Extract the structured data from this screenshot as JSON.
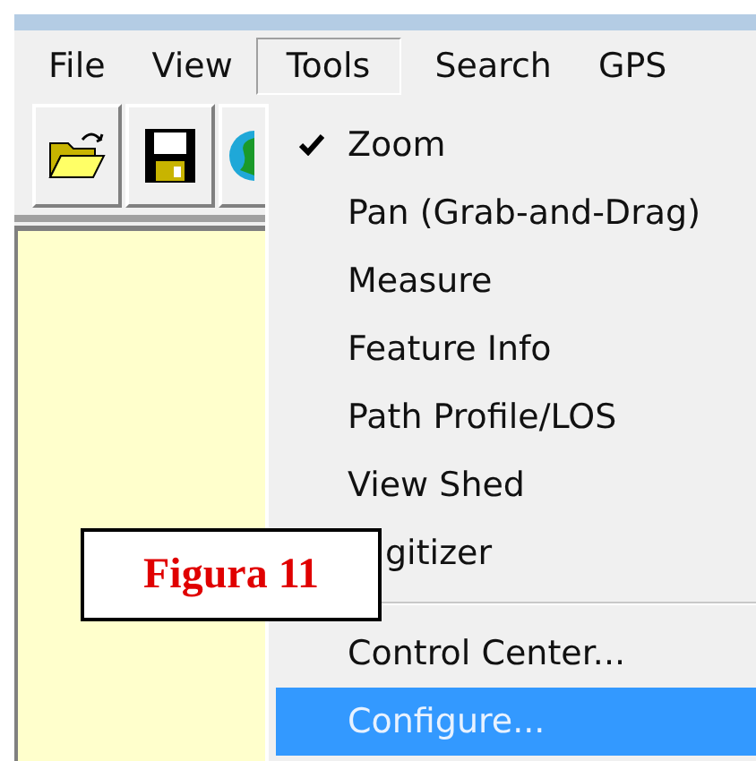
{
  "menu_bar": [
    {
      "label": "File",
      "selected": false
    },
    {
      "label": "View",
      "selected": false
    },
    {
      "label": "Tools",
      "selected": true
    },
    {
      "label": "Search",
      "selected": false
    },
    {
      "label": "GPS",
      "selected": false
    }
  ],
  "tools_menu": [
    {
      "kind": "item",
      "label": "Zoom",
      "checked": true,
      "selected": false
    },
    {
      "kind": "item",
      "label": "Pan (Grab-and-Drag)",
      "checked": false,
      "selected": false
    },
    {
      "kind": "item",
      "label": "Measure",
      "checked": false,
      "selected": false
    },
    {
      "kind": "item",
      "label": "Feature Info",
      "checked": false,
      "selected": false
    },
    {
      "kind": "item",
      "label": "Path Profile/LOS",
      "checked": false,
      "selected": false
    },
    {
      "kind": "item",
      "label": "View Shed",
      "checked": false,
      "selected": false
    },
    {
      "kind": "covered",
      "label": "gitizer",
      "selected": false
    },
    {
      "kind": "separator"
    },
    {
      "kind": "item",
      "label": "Control Center...",
      "checked": false,
      "selected": false
    },
    {
      "kind": "item",
      "label": "Configure...",
      "checked": false,
      "selected": true
    }
  ],
  "figure_label": "Figura 11"
}
